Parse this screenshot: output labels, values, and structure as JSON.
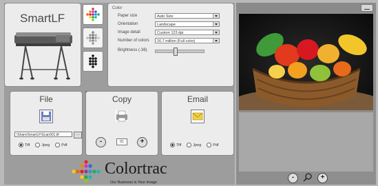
{
  "brand": {
    "title": "SmartLF"
  },
  "settings": {
    "header": "Color",
    "rows": [
      {
        "label": "Paper size",
        "value": "Auto Size"
      },
      {
        "label": "Orientation",
        "value": "Landscape"
      },
      {
        "label": "Image detail",
        "value": "Custom 123 dpi"
      },
      {
        "label": "Number of colors",
        "value": "16.7 million (Full color)"
      }
    ],
    "brightness_label": "Brightness (-36)",
    "brightness_value": -36
  },
  "file": {
    "title": "File",
    "path": "\\Share\\SmartLF\\Scan001.tif",
    "browse": "...",
    "formats": [
      "Tiff",
      "Jpeg",
      "Pdf"
    ],
    "selected": "Tiff"
  },
  "copy": {
    "title": "Copy",
    "count": "01",
    "minus": "-",
    "plus": "+",
    "info": "i"
  },
  "email": {
    "title": "Email",
    "formats": [
      "Tiff",
      "Jpeg",
      "Pdf"
    ],
    "selected": "Tiff"
  },
  "logo": {
    "word": "Colortrac",
    "tagline": "Our Business is Your Image"
  },
  "preview": {
    "zoom_out": "-",
    "zoom_in": "+"
  },
  "colors": {
    "accent": "#f0d040",
    "panel": "#ececec",
    "background": "#9d9d9d"
  }
}
